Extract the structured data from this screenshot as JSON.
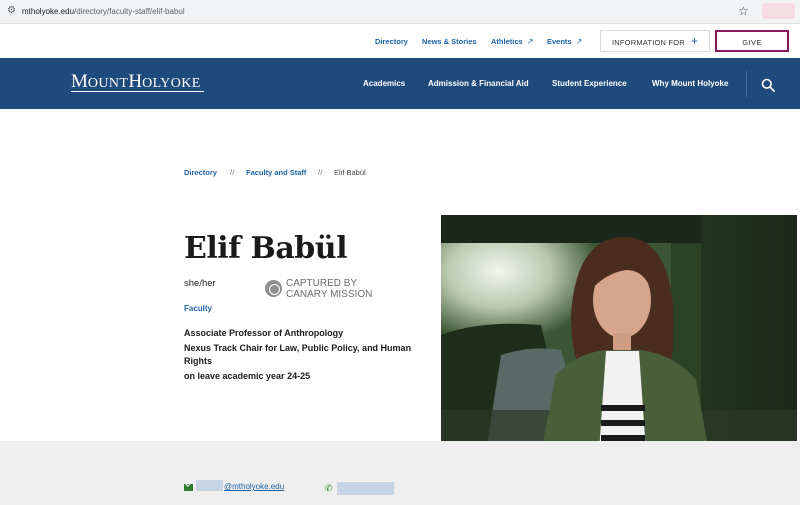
{
  "browser": {
    "url_host": "mtholyoke.edu",
    "url_path": "/directory/faculty-staff/elif-babul"
  },
  "utility_nav": {
    "links": [
      "Directory",
      "News & Stories",
      "Athletics",
      "Events"
    ],
    "info_for_label": "INFORMATION FOR",
    "info_for_plus": "+",
    "give_label": "GIVE"
  },
  "logo": {
    "m": "M",
    "ount": "OUNT",
    "h": "H",
    "olyoke": "OLYOKE"
  },
  "main_nav": {
    "items": [
      "Academics",
      "Admission & Financial Aid",
      "Student Experience",
      "Why Mount Holyoke"
    ]
  },
  "breadcrumb": {
    "items": [
      "Directory",
      "Faculty and Staff",
      "Elif Babül"
    ],
    "separator": "//"
  },
  "profile": {
    "name": "Elif Babül",
    "pronouns": "she/her",
    "stamp_line1": "CAPTURED BY",
    "stamp_line2": "CANARY MISSION",
    "role": "Faculty",
    "titles": [
      "Associate Professor of Anthropology",
      "Nexus Track Chair for Law, Public Policy, and Human Rights",
      "on leave academic year 24-25"
    ]
  },
  "contact": {
    "email_domain": "@mtholyoke.edu"
  },
  "colors": {
    "brand_blue": "#1e4a7c",
    "link_blue": "#1c64a8",
    "give_border": "#8b1a5c",
    "contact_icon_green": "#2f7a2f"
  }
}
